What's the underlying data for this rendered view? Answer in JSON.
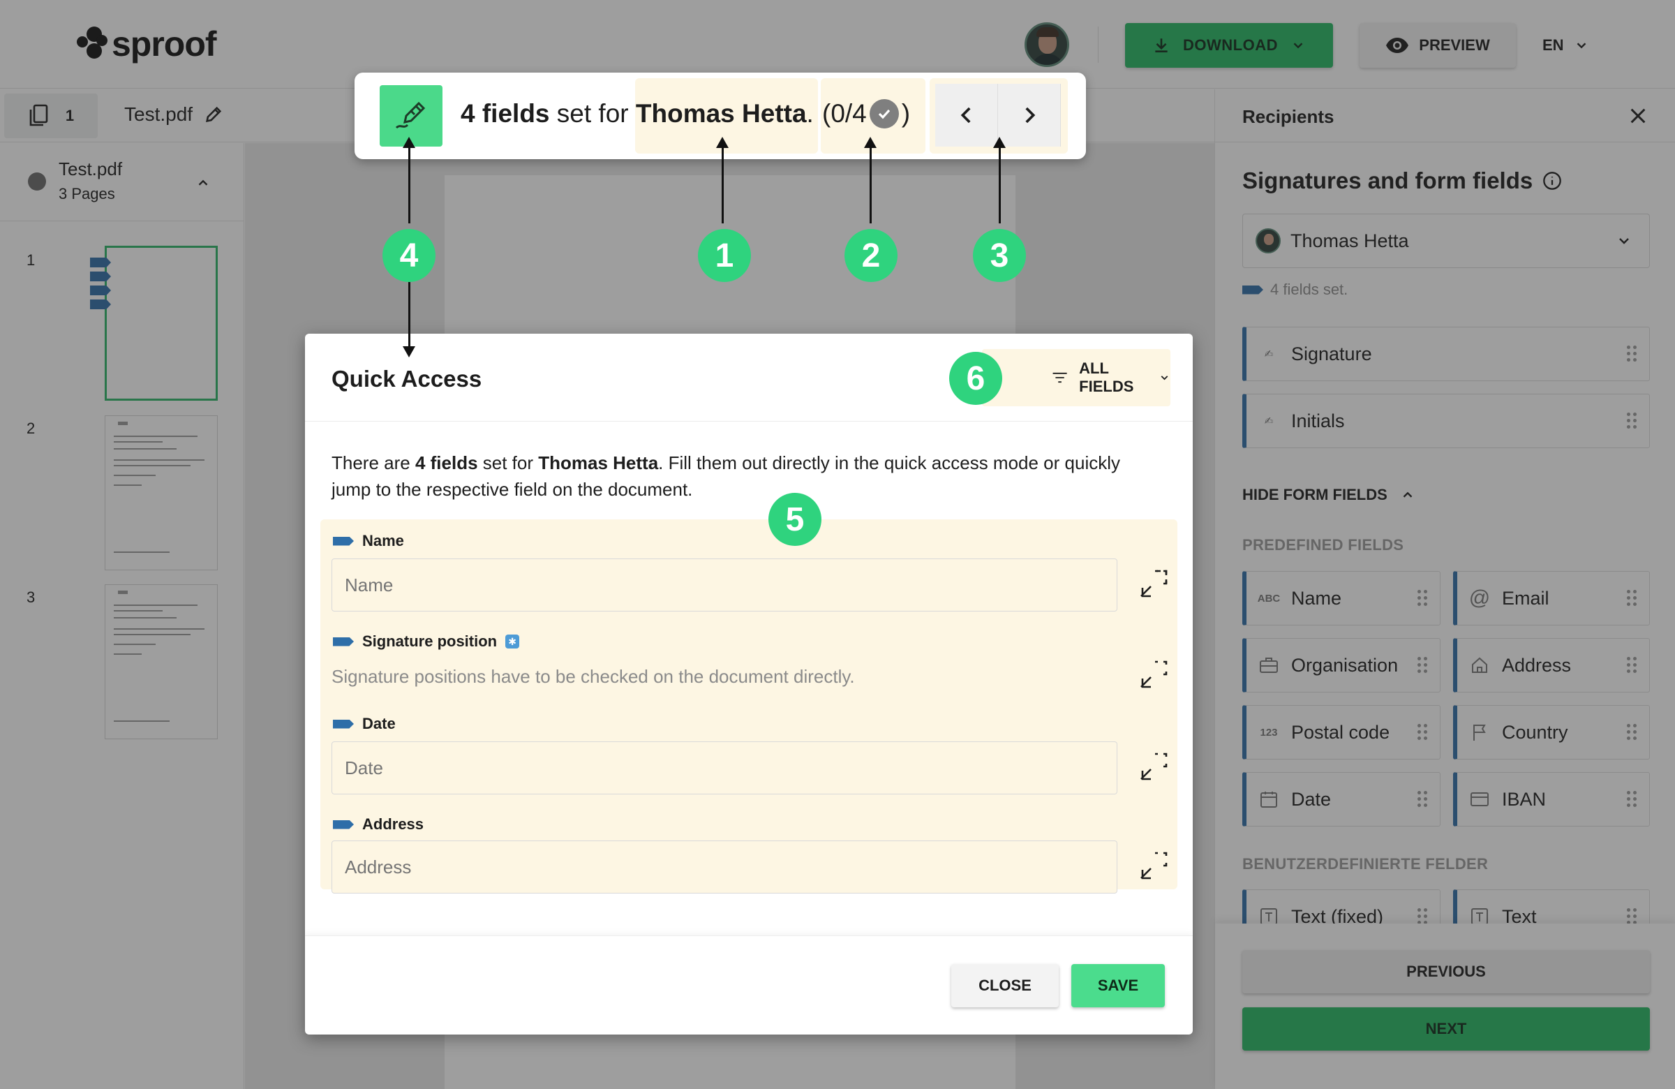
{
  "header": {
    "logo_text": "sproof",
    "download_label": "DOWNLOAD",
    "preview_label": "PREVIEW",
    "language": "EN"
  },
  "tabbar": {
    "page_count": "1",
    "filename": "Test.pdf"
  },
  "sidebar": {
    "doc_name": "Test.pdf",
    "doc_pages": "3 Pages",
    "thumbnails": [
      "1",
      "2",
      "3"
    ]
  },
  "topbar": {
    "count_bold": "4 fields",
    "set_for": " set for ",
    "recipient": "Thomas Hetta",
    "period": ".",
    "progress_open": "(0/4",
    "progress_close": ")"
  },
  "modal": {
    "title": "Quick Access",
    "filter_label": "ALL FIELDS",
    "intro": {
      "p1": "There are ",
      "count": "4 fields",
      "p2": " set for ",
      "recipient": "Thomas Hetta",
      "p3": ". Fill them out directly in the quick access mode or quickly jump to the respective field on the document."
    },
    "fields": [
      {
        "label": "Name",
        "placeholder": "Name"
      },
      {
        "label": "Signature position",
        "note": "Signature positions have to be checked on the document directly."
      },
      {
        "label": "Date",
        "placeholder": "Date"
      },
      {
        "label": "Address",
        "placeholder": "Address"
      }
    ],
    "close_label": "CLOSE",
    "save_label": "SAVE"
  },
  "right_panel": {
    "header": "Recipients",
    "title": "Signatures and form fields",
    "recipient": "Thomas Hetta",
    "fields_count": "4 fields set.",
    "signature_fields": [
      "Signature",
      "Initials"
    ],
    "hide_form_fields": "HIDE FORM FIELDS",
    "predefined_label": "PREDEFINED FIELDS",
    "predefined": [
      {
        "label": "Name",
        "icon": "ABC"
      },
      {
        "label": "Email",
        "icon": "at-icon"
      },
      {
        "label": "Organisation",
        "icon": "briefcase-icon"
      },
      {
        "label": "Address",
        "icon": "home-icon"
      },
      {
        "label": "Postal code",
        "icon": "123"
      },
      {
        "label": "Country",
        "icon": "flag-icon"
      },
      {
        "label": "Date",
        "icon": "calendar-icon"
      },
      {
        "label": "IBAN",
        "icon": "card-icon"
      }
    ],
    "custom_label": "BENUTZERDEFINIERTE FELDER",
    "custom": [
      "Text (fixed)",
      "Text"
    ],
    "previous_label": "PREVIOUS",
    "next_label": "NEXT"
  },
  "callouts": [
    "1",
    "2",
    "3",
    "4",
    "5",
    "6"
  ],
  "colors": {
    "accent_green": "#25b863",
    "callout_green": "#2fd37e",
    "field_blue": "#2e6ea8",
    "highlight_cream": "#fdf6e3"
  }
}
